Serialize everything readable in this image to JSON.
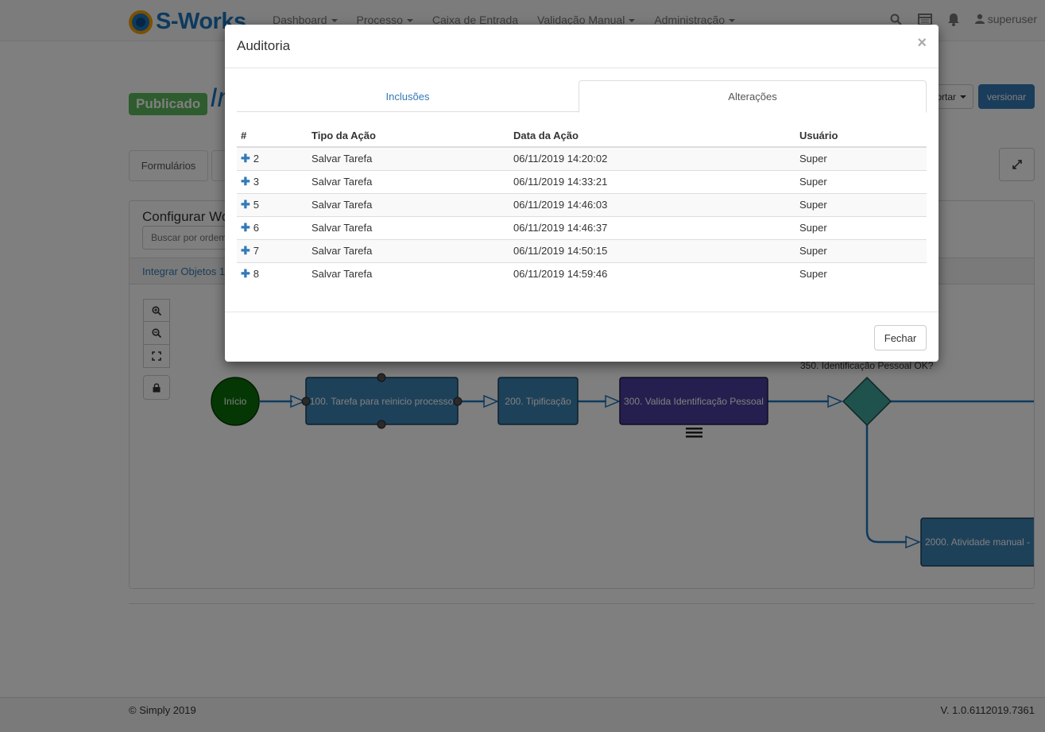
{
  "navbar": {
    "brand": "S-Works",
    "menu": [
      {
        "label": "Dashboard",
        "dropdown": true
      },
      {
        "label": "Processo",
        "dropdown": true
      },
      {
        "label": "Caixa de Entrada",
        "dropdown": false
      },
      {
        "label": "Validação Manual",
        "dropdown": true
      },
      {
        "label": "Administração",
        "dropdown": true
      }
    ],
    "icons": [
      "search-icon",
      "calendar-icon",
      "bell-icon",
      "user-icon"
    ],
    "user": "superuser"
  },
  "page": {
    "status_badge": "Publicado",
    "title_fragment": "In",
    "export_label": "ortar",
    "version_label": "versionar",
    "tab_forms": "Formulários",
    "panel_title": "Configurar Wo",
    "search_placeholder": "Buscar por ordem",
    "bar_text": "Integrar Objetos 1"
  },
  "flow": {
    "start_label": "Início",
    "task_100": "100. Tarefa para reinicio processo",
    "task_200": "200. Tipificação",
    "task_300": "300. Valida Identificação Pessoal",
    "gateway_label": "350. Identificação Pessoal OK?",
    "task_2000": "2000. Atividade manual -",
    "colors": {
      "start": "#0a6e0a",
      "task": "#3d82b5",
      "task_selected": "#4b3f9e",
      "gateway": "#3fa39a",
      "edge": "#1c75bc"
    }
  },
  "footer": {
    "copyright": "© Simply 2019",
    "version": "V. 1.0.6112019.7361"
  },
  "modal": {
    "title": "Auditoria",
    "close_symbol": "×",
    "tabs": [
      {
        "label": "Inclusões",
        "active": false
      },
      {
        "label": "Alterações",
        "active": true
      }
    ],
    "columns": [
      "#",
      "Tipo da Ação",
      "Data da Ação",
      "Usuário"
    ],
    "rows": [
      {
        "id": "2",
        "action": "Salvar Tarefa",
        "date": "06/11/2019 14:20:02",
        "user": "Super"
      },
      {
        "id": "3",
        "action": "Salvar Tarefa",
        "date": "06/11/2019 14:33:21",
        "user": "Super"
      },
      {
        "id": "5",
        "action": "Salvar Tarefa",
        "date": "06/11/2019 14:46:03",
        "user": "Super"
      },
      {
        "id": "6",
        "action": "Salvar Tarefa",
        "date": "06/11/2019 14:46:37",
        "user": "Super"
      },
      {
        "id": "7",
        "action": "Salvar Tarefa",
        "date": "06/11/2019 14:50:15",
        "user": "Super"
      },
      {
        "id": "8",
        "action": "Salvar Tarefa",
        "date": "06/11/2019 14:59:46",
        "user": "Super"
      }
    ],
    "close_button": "Fechar"
  }
}
